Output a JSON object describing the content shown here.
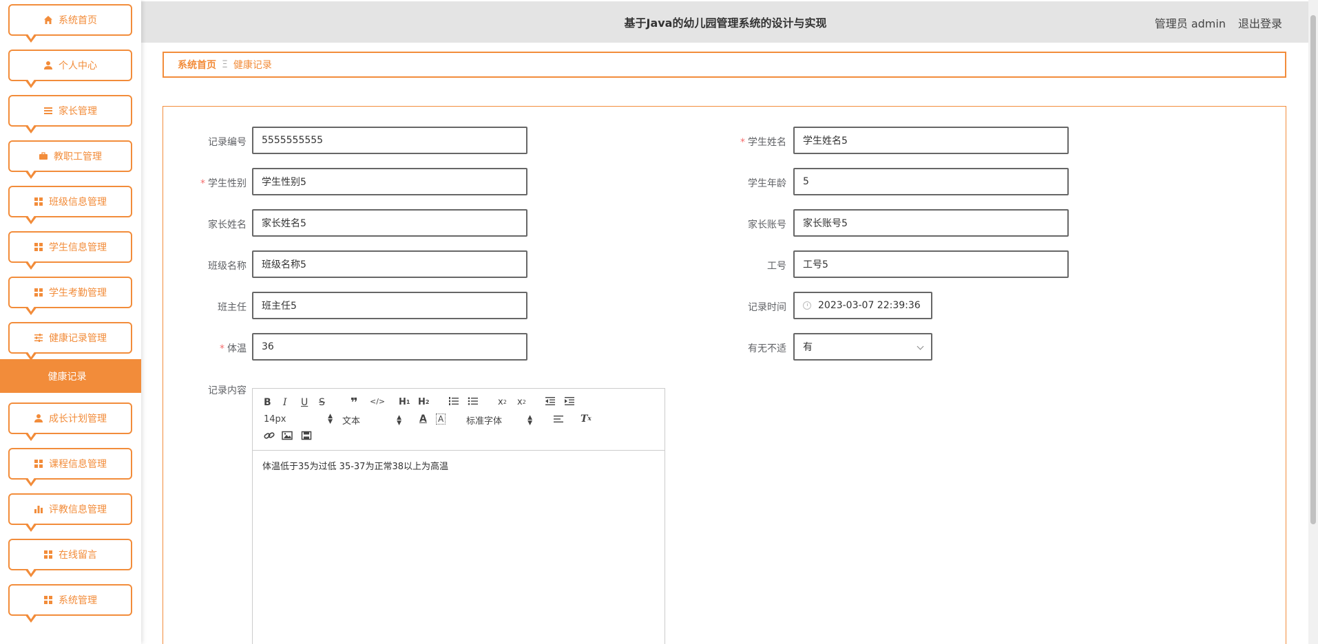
{
  "header": {
    "title": "基于Java的幼儿园管理系统的设计与实现",
    "user_label": "管理员 admin",
    "logout_label": "退出登录"
  },
  "sidebar": {
    "items": [
      {
        "label": "系统首页",
        "icon": "home-icon"
      },
      {
        "label": "个人中心",
        "icon": "user-icon"
      },
      {
        "label": "家长管理",
        "icon": "list-icon"
      },
      {
        "label": "教职工管理",
        "icon": "briefcase-icon"
      },
      {
        "label": "班级信息管理",
        "icon": "grid-icon"
      },
      {
        "label": "学生信息管理",
        "icon": "grid-icon"
      },
      {
        "label": "学生考勤管理",
        "icon": "grid-icon"
      },
      {
        "label": "健康记录管理",
        "icon": "sliders-icon"
      },
      {
        "label": "成长计划管理",
        "icon": "user-icon"
      },
      {
        "label": "课程信息管理",
        "icon": "grid-icon"
      },
      {
        "label": "评教信息管理",
        "icon": "bar-chart-icon"
      },
      {
        "label": "在线留言",
        "icon": "grid-icon"
      },
      {
        "label": "系统管理",
        "icon": "grid-icon"
      }
    ],
    "active_sub": "健康记录"
  },
  "breadcrumb": {
    "home": "系统首页",
    "separator": "Ξ",
    "current": "健康记录"
  },
  "form": {
    "record_no": {
      "label": "记录编号",
      "value": "5555555555"
    },
    "student_name": {
      "label": "学生姓名",
      "value": "学生姓名5"
    },
    "student_gender": {
      "label": "学生性别",
      "value": "学生性别5"
    },
    "student_age": {
      "label": "学生年龄",
      "value": "5"
    },
    "parent_name": {
      "label": "家长姓名",
      "value": "家长姓名5"
    },
    "parent_account": {
      "label": "家长账号",
      "value": "家长账号5"
    },
    "class_name": {
      "label": "班级名称",
      "value": "班级名称5"
    },
    "staff_no": {
      "label": "工号",
      "value": "工号5"
    },
    "head_teacher": {
      "label": "班主任",
      "value": "班主任5"
    },
    "record_time": {
      "label": "记录时间",
      "value": "2023-03-07 22:39:36"
    },
    "temperature": {
      "label": "体温",
      "value": "36"
    },
    "discomfort": {
      "label": "有无不适",
      "value": "有"
    },
    "content_label": "记录内容",
    "required_mark": "*"
  },
  "editor": {
    "font_size": "14px",
    "text_style": "文本",
    "font_family": "标准字体",
    "content": "体温低于35为过低 35-37为正常38以上为高温"
  },
  "colors": {
    "accent": "#f28c3a",
    "header_bg": "#e4e4e4",
    "required": "#f56c6c"
  }
}
